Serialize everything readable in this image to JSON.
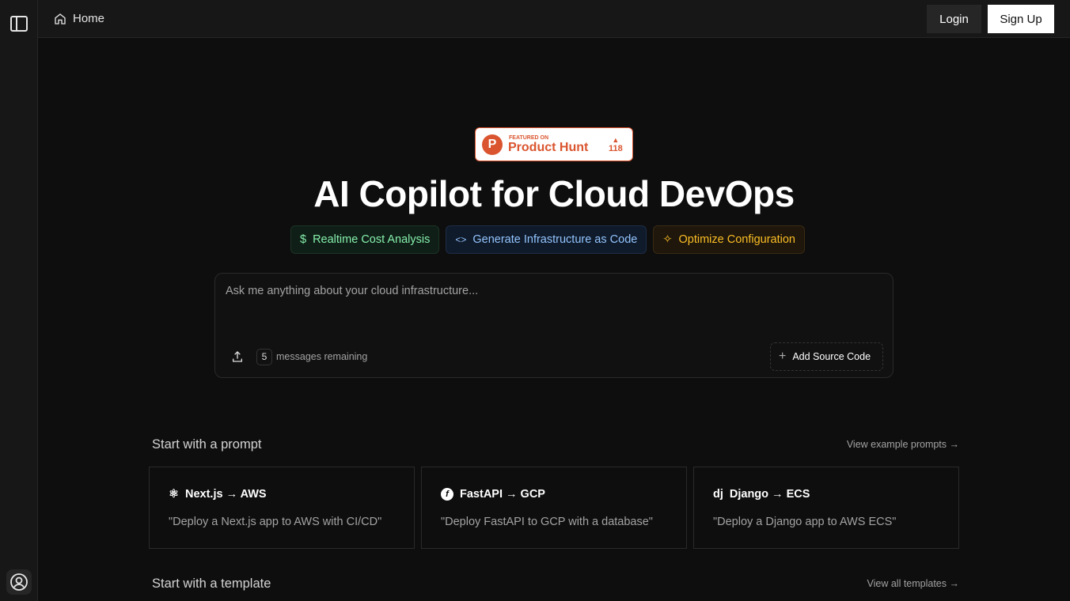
{
  "header": {
    "home_label": "Home",
    "login_label": "Login",
    "signup_label": "Sign Up"
  },
  "badge": {
    "featured": "FEATURED ON",
    "name": "Product Hunt",
    "count": "118"
  },
  "hero": {
    "title": "AI Copilot for Cloud DevOps"
  },
  "chips": [
    {
      "label": "Realtime Cost Analysis",
      "icon": "dollar-icon"
    },
    {
      "label": "Generate Infrastructure as Code",
      "icon": "code-icon"
    },
    {
      "label": "Optimize Configuration",
      "icon": "sparkle-icon"
    }
  ],
  "prompt": {
    "placeholder": "Ask me anything about your cloud infrastructure...",
    "messages_count": "5",
    "messages_label": "messages remaining",
    "add_source_label": "Add Source Code"
  },
  "sections": {
    "prompt_title": "Start with a prompt",
    "prompt_link": "View example prompts →",
    "template_title": "Start with a template",
    "template_link": "View all templates →"
  },
  "cards": [
    {
      "title": "Next.js → AWS",
      "desc": "\"Deploy a Next.js app to AWS with CI/CD\""
    },
    {
      "title": "FastAPI → GCP",
      "desc": "\"Deploy FastAPI to GCP with a database\""
    },
    {
      "title": "Django → ECS",
      "desc": "\"Deploy a Django app to AWS ECS\""
    }
  ]
}
